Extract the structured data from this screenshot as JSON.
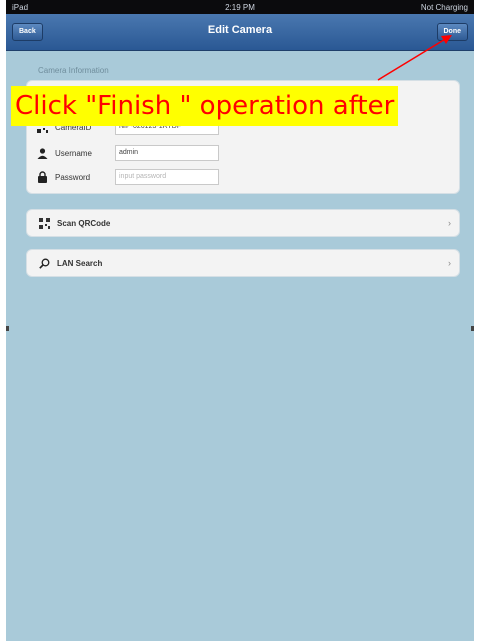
{
  "status_bar": {
    "carrier": "iPad",
    "time": "2:19 PM",
    "battery": "Not Charging"
  },
  "nav": {
    "back_label": "Back",
    "title": "Edit Camera",
    "done_label": "Done"
  },
  "camera_info": {
    "section_header": "Camera Information",
    "rows": [
      {
        "label": "CameraID",
        "value": "NIP-026123-1RTDF",
        "icon": "qr-code-icon"
      },
      {
        "label": "Username",
        "value": "admin",
        "icon": "user-icon"
      },
      {
        "label": "Password",
        "placeholder": "input password",
        "icon": "lock-icon"
      }
    ]
  },
  "actions": {
    "scan_label": "Scan QRCode",
    "lan_label": "LAN Search"
  },
  "annotation": {
    "text": "Click \"Finish \" operation after",
    "text_color": "#ff0000",
    "background": "#ffff00"
  },
  "colors": {
    "background": "#a9cad9",
    "navbar": "#2a5894"
  }
}
